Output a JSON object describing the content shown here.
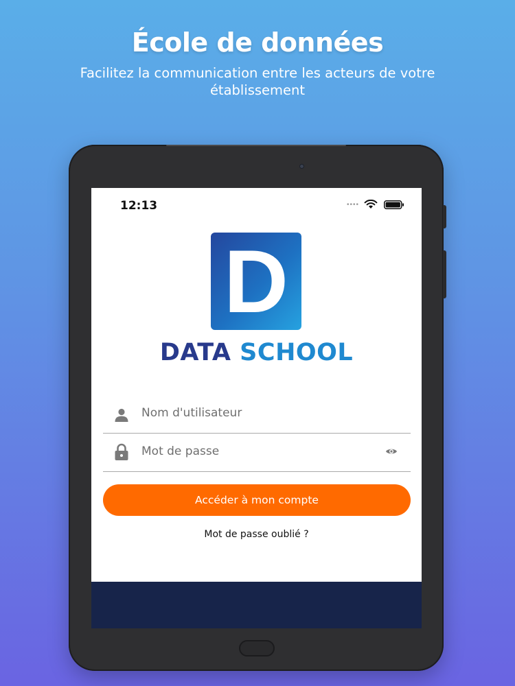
{
  "headline": "École de données",
  "subheadline": "Facilitez la communication entre les acteurs de votre établissement",
  "status_bar": {
    "time": "12:13",
    "icons": [
      "signal-dots-icon",
      "wifi-icon",
      "battery-icon"
    ]
  },
  "logo": {
    "letter": "D",
    "brand_word_1": "DATA",
    "brand_word_2": "SCHOOL"
  },
  "login_form": {
    "username_placeholder": "Nom d'utilisateur",
    "password_placeholder": "Mot de passe",
    "submit_label": "Accéder à mon compte",
    "forgot_password_link": "Mot de passe oublié ?"
  },
  "colors": {
    "background_top": "#5aaee8",
    "background_bottom": "#6a64e2",
    "accent_orange": "#ff6a00",
    "brand_dark_blue": "#283a8c",
    "brand_light_blue": "#1f89d0",
    "footer_navy": "#17244a"
  }
}
